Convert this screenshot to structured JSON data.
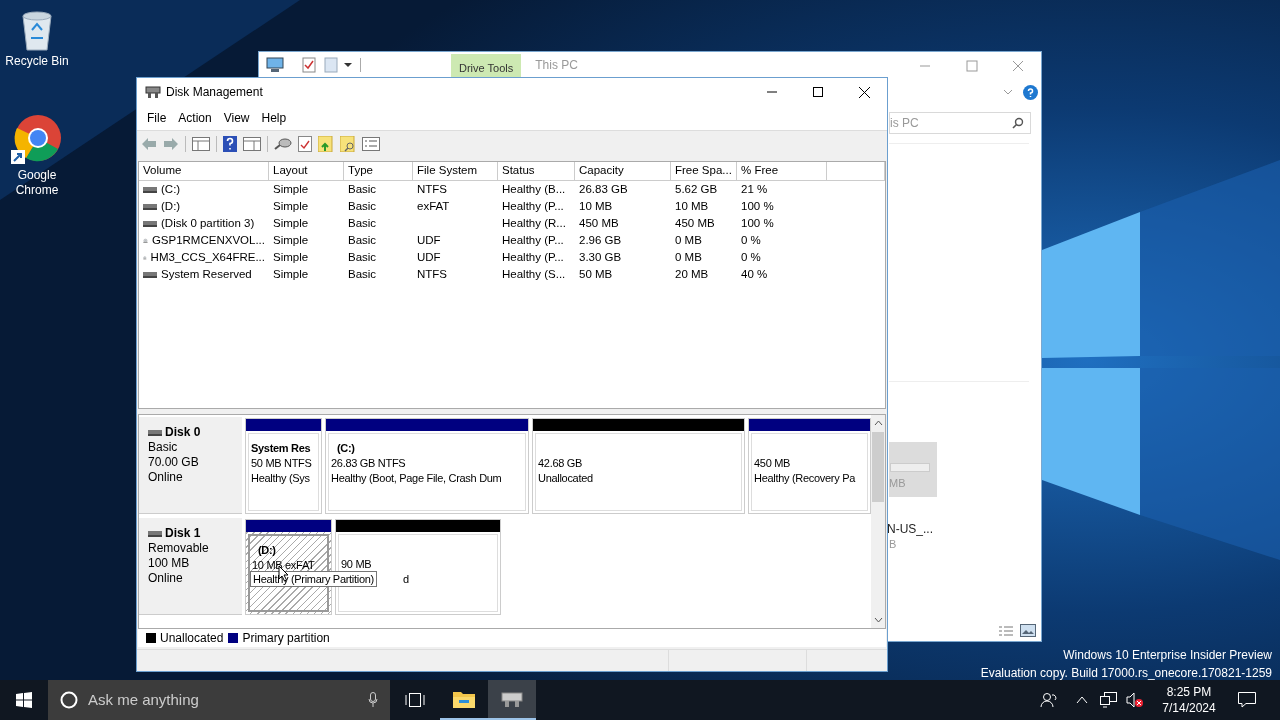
{
  "desktop": {
    "icons": [
      {
        "label": "Recycle Bin",
        "kind": "recycle"
      },
      {
        "label": "Google Chrome",
        "kind": "browser"
      }
    ],
    "watermark": [
      "Windows 10 Enterprise Insider Preview",
      "Evaluation copy. Build 17000.rs_onecore.170821-1259"
    ]
  },
  "explorer": {
    "context_tab": "Drive Tools",
    "title": "This PC",
    "search": {
      "value": "is PC"
    },
    "fragments": [
      "MB",
      "N-US_...",
      "B"
    ]
  },
  "disk_management": {
    "title": "Disk Management",
    "menu": [
      "File",
      "Action",
      "View",
      "Help"
    ],
    "table": {
      "columns": [
        "Volume",
        "Layout",
        "Type",
        "File System",
        "Status",
        "Capacity",
        "Free Spa...",
        "% Free"
      ],
      "rows": [
        {
          "kind": "disk",
          "cells": [
            "(C:)",
            "Simple",
            "Basic",
            "NTFS",
            "Healthy (B...",
            "26.83 GB",
            "5.62 GB",
            "21 %"
          ]
        },
        {
          "kind": "disk",
          "cells": [
            "(D:)",
            "Simple",
            "Basic",
            "exFAT",
            "Healthy (P...",
            "10 MB",
            "10 MB",
            "100 %"
          ]
        },
        {
          "kind": "disk",
          "cells": [
            "(Disk 0 partition 3)",
            "Simple",
            "Basic",
            "",
            "Healthy (R...",
            "450 MB",
            "450 MB",
            "100 %"
          ]
        },
        {
          "kind": "optical",
          "cells": [
            "GSP1RMCENXVOL...",
            "Simple",
            "Basic",
            "UDF",
            "Healthy (P...",
            "2.96 GB",
            "0 MB",
            "0 %"
          ]
        },
        {
          "kind": "optical",
          "cells": [
            "HM3_CCS_X64FRE...",
            "Simple",
            "Basic",
            "UDF",
            "Healthy (P...",
            "3.30 GB",
            "0 MB",
            "0 %"
          ]
        },
        {
          "kind": "disk",
          "cells": [
            "System Reserved",
            "Simple",
            "Basic",
            "NTFS",
            "Healthy (S...",
            "50 MB",
            "20 MB",
            "40 %"
          ]
        }
      ]
    },
    "disks": [
      {
        "name": "Disk 0",
        "lines": [
          "Basic",
          "70.00 GB",
          "Online"
        ],
        "partitions": [
          {
            "kind": "primary",
            "selected": false,
            "title": "System Res",
            "lines": [
              "50 MB NTFS",
              "Healthy (Sys"
            ]
          },
          {
            "kind": "primary",
            "selected": false,
            "title": "(C:)",
            "lines": [
              "26.83 GB NTFS",
              "Healthy (Boot, Page File, Crash Dum"
            ]
          },
          {
            "kind": "unallocated",
            "selected": false,
            "lines": [
              "42.68 GB",
              "Unallocated"
            ]
          },
          {
            "kind": "primary",
            "selected": false,
            "lines": [
              "450 MB",
              "Healthy (Recovery Pa"
            ]
          }
        ]
      },
      {
        "name": "Disk 1",
        "lines": [
          "Removable",
          "100 MB",
          "Online"
        ],
        "tooltip": "Healthy (Primary Partition)",
        "partitions": [
          {
            "kind": "primary",
            "selected": true,
            "title": "(D:)",
            "lines": [
              "10 MB exFAT"
            ]
          },
          {
            "kind": "unallocated",
            "selected": false,
            "lines": [
              "90 MB",
              "d"
            ]
          }
        ]
      }
    ],
    "legend": [
      {
        "label": "Unallocated",
        "color": "#000000"
      },
      {
        "label": "Primary partition",
        "color": "#000080"
      }
    ]
  },
  "taskbar": {
    "search": {
      "placeholder": "Ask me anything"
    },
    "apps": [
      {
        "kind": "explorer",
        "selected": false
      },
      {
        "kind": "disk",
        "selected": true
      }
    ],
    "time": "8:25 PM",
    "date": "7/14/2024"
  }
}
